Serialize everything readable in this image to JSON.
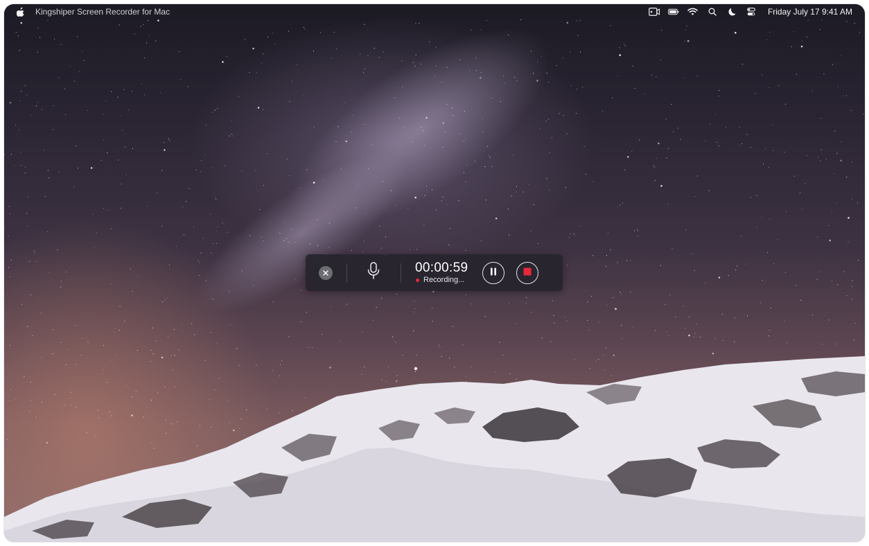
{
  "menubar": {
    "app_title": "Kingshiper Screen Recorder for Mac",
    "clock": "Friday July 17  9:41 AM",
    "icons": [
      "apple-icon",
      "screen-record-icon",
      "battery-icon",
      "wifi-icon",
      "search-icon",
      "moon-icon",
      "control-center-icon"
    ]
  },
  "recorder": {
    "timer": "00:00:59",
    "status": "Recording...",
    "accent_color": "#e8283a",
    "buttons": [
      "close-icon",
      "microphone-icon",
      "pause-icon",
      "stop-icon"
    ]
  }
}
